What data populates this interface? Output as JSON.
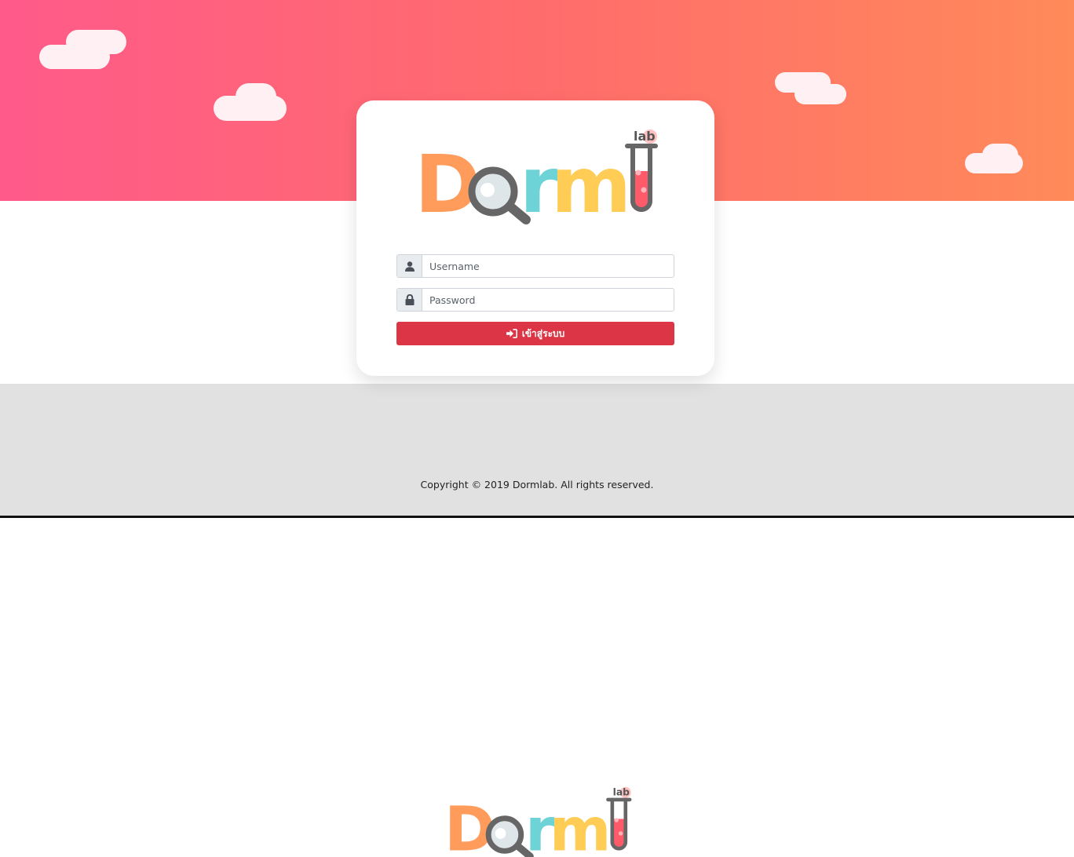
{
  "login": {
    "username_placeholder": "Username",
    "password_placeholder": "Password",
    "submit_label": "เข้าสู่ระบบ"
  },
  "logo": {
    "letters": [
      "D",
      "r",
      "m"
    ],
    "badge": "lab",
    "colors": {
      "d": "#ff9c5c",
      "r": "#6dd3d6",
      "m": "#ffcc55",
      "magnifier": "#666666",
      "tube_liquid": "#ff5a6a"
    }
  },
  "footer": {
    "copyright": "Copyright © 2019 Dormlab. All rights reserved."
  },
  "colors": {
    "hero_gradient": [
      "#ff5a8a",
      "#ff8a5a"
    ],
    "button": "#dc3545",
    "footer_bg": "#e1e1e1"
  },
  "icons": [
    "user-icon",
    "lock-icon",
    "sign-in-icon",
    "magnifier-icon",
    "test-tube-icon",
    "cloud-icon"
  ]
}
